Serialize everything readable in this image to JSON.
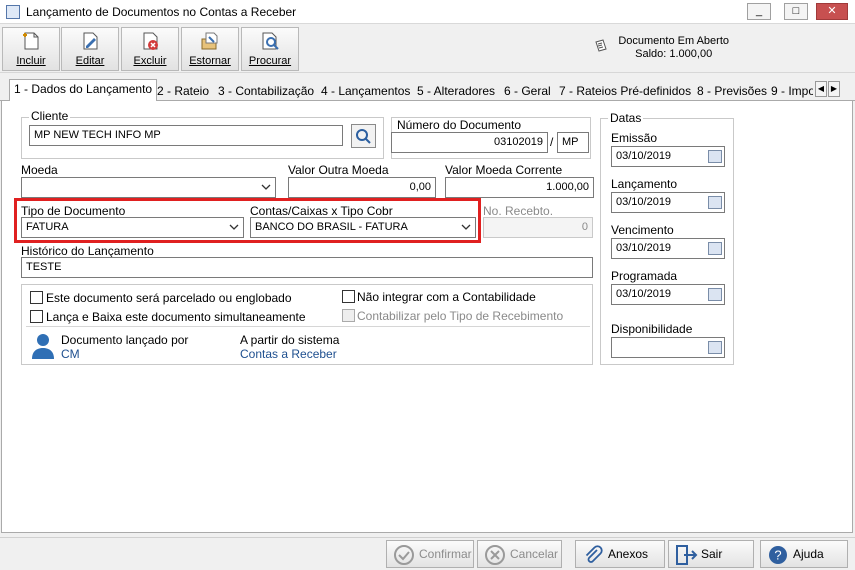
{
  "window": {
    "title": "Lançamento de Documentos no Contas a Receber",
    "minimize": "_",
    "maximize": "□",
    "close": "✕"
  },
  "toolbar": {
    "incluir": "Incluir",
    "editar": "Editar",
    "excluir": "Excluir",
    "estornar": "Estornar",
    "procurar": "Procurar"
  },
  "status": {
    "line1": "Documento Em Aberto",
    "line2": "Saldo: 1.000,00"
  },
  "tabs": [
    "1 - Dados do Lançamento",
    "2 - Rateio",
    "3 - Contabilização",
    "4 - Lançamentos",
    "5 - Alteradores",
    "6 - Geral",
    "7 - Rateios Pré-definidos",
    "8 - Previsões",
    "9 - Impo"
  ],
  "form": {
    "cliente_label": "Cliente",
    "cliente_value": "MP NEW TECH INFO MP",
    "numero_label": "Número do Documento",
    "numero_value": "03102019",
    "numero_sep": "/",
    "numero_suffix": "MP",
    "moeda_label": "Moeda",
    "moeda_value": "",
    "valor_outra_label": "Valor Outra Moeda",
    "valor_outra_value": "0,00",
    "valor_corrente_label": "Valor Moeda Corrente",
    "valor_corrente_value": "1.000,00",
    "tipo_doc_label": "Tipo de Documento",
    "tipo_doc_value": "FATURA",
    "contas_label": "Contas/Caixas x Tipo Cobr",
    "contas_value": "BANCO DO BRASIL - FATURA",
    "no_recebto_label": "No. Recebto.",
    "no_recebto_value": "0",
    "historico_label": "Histórico do Lançamento",
    "historico_value": "TESTE",
    "chk_parcelado": "Este documento será parcelado ou englobado",
    "chk_lanca_baixa": "Lança e Baixa este documento simultaneamente",
    "chk_nao_integrar": "Não integrar com a Contabilidade",
    "chk_contabilizar": "Contabilizar pelo Tipo de Recebimento",
    "lancado_por_label": "Documento lançado por",
    "lancado_por_value": "CM",
    "a_partir_label": "A partir do sistema",
    "a_partir_value": "Contas a Receber"
  },
  "datas": {
    "title": "Datas",
    "emissao_label": "Emissão",
    "emissao_value": "03/10/2019",
    "lancamento_label": "Lançamento",
    "lancamento_value": "03/10/2019",
    "vencimento_label": "Vencimento",
    "vencimento_value": "03/10/2019",
    "programada_label": "Programada",
    "programada_value": "03/10/2019",
    "disponibilidade_label": "Disponibilidade",
    "disponibilidade_value": ""
  },
  "buttons": {
    "confirmar": "Confirmar",
    "cancelar": "Cancelar",
    "anexos": "Anexos",
    "sair": "Sair",
    "ajuda": "Ajuda"
  }
}
